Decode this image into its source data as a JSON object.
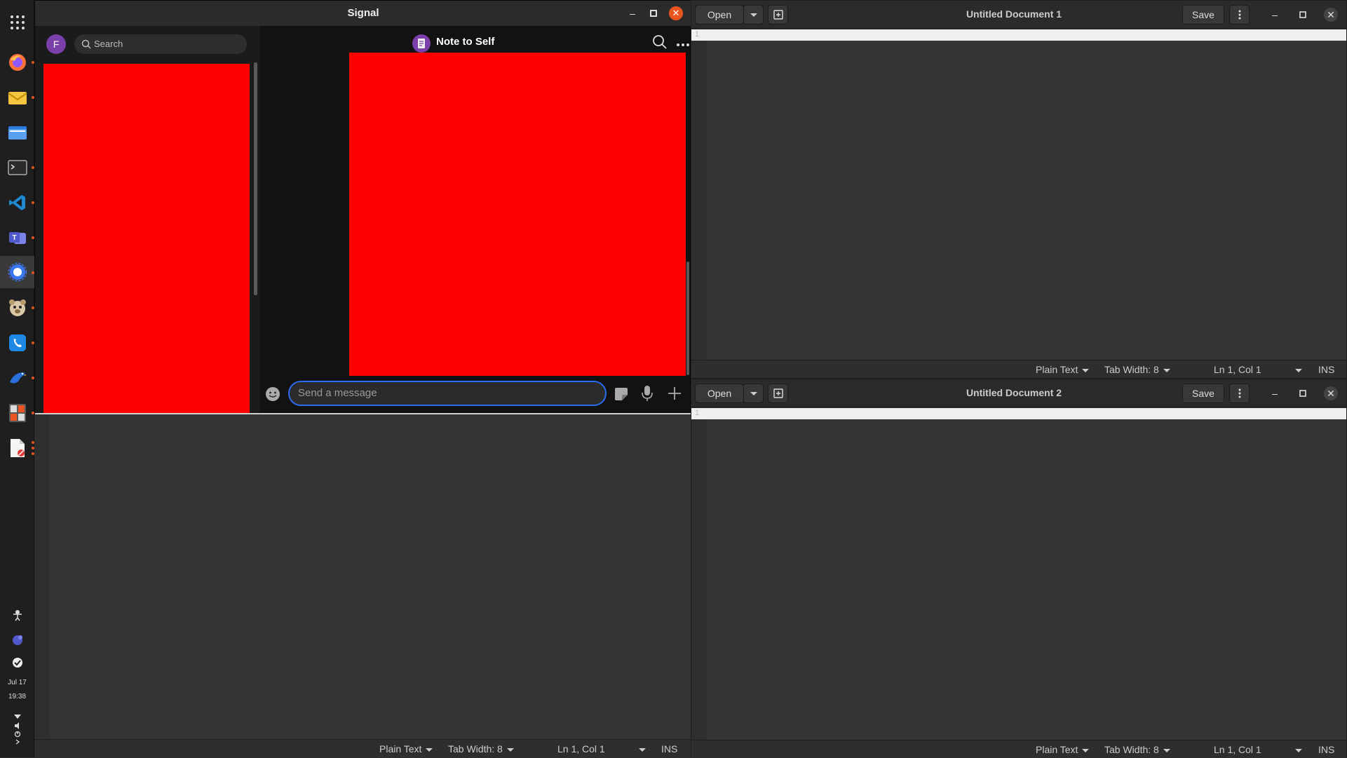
{
  "dock": {
    "apps": [
      {
        "name": "apps-grid-icon"
      },
      {
        "name": "firefox-icon"
      },
      {
        "name": "mail-icon"
      },
      {
        "name": "files-icon"
      },
      {
        "name": "terminal-icon"
      },
      {
        "name": "vscode-icon"
      },
      {
        "name": "teams-icon"
      },
      {
        "name": "signal-icon"
      },
      {
        "name": "bear-icon"
      },
      {
        "name": "phone-icon"
      },
      {
        "name": "bird-icon"
      },
      {
        "name": "calculator-icon"
      },
      {
        "name": "document-icon"
      }
    ],
    "tray": {
      "date": "Jul 17",
      "time": "19:38"
    }
  },
  "signal": {
    "window_title": "Signal",
    "avatar_letter": "F",
    "search_placeholder": "Search",
    "conversation_title": "Note to Self",
    "composer_placeholder": "Send a message"
  },
  "gedit_windows": [
    {
      "open_label": "Open",
      "title": "Untitled Document 1",
      "save_label": "Save",
      "line_number": "1",
      "status": {
        "language": "Plain Text",
        "tab_width": "Tab Width: 8",
        "position": "Ln 1, Col 1",
        "mode": "INS"
      }
    },
    {
      "open_label": "Open",
      "title": "Untitled Document 2",
      "save_label": "Save",
      "line_number": "1",
      "status": {
        "language": "Plain Text",
        "tab_width": "Tab Width: 8",
        "position": "Ln 1, Col 1",
        "mode": "INS"
      }
    }
  ],
  "bottom_left_status": {
    "language": "Plain Text",
    "tab_width": "Tab Width: 8",
    "position": "Ln 1, Col 1",
    "mode": "INS"
  },
  "colors": {
    "accent": "#e95420",
    "signal_blue": "#2c6bed",
    "redacted": "#ff0000",
    "avatar_purple": "#7a3fa8"
  }
}
